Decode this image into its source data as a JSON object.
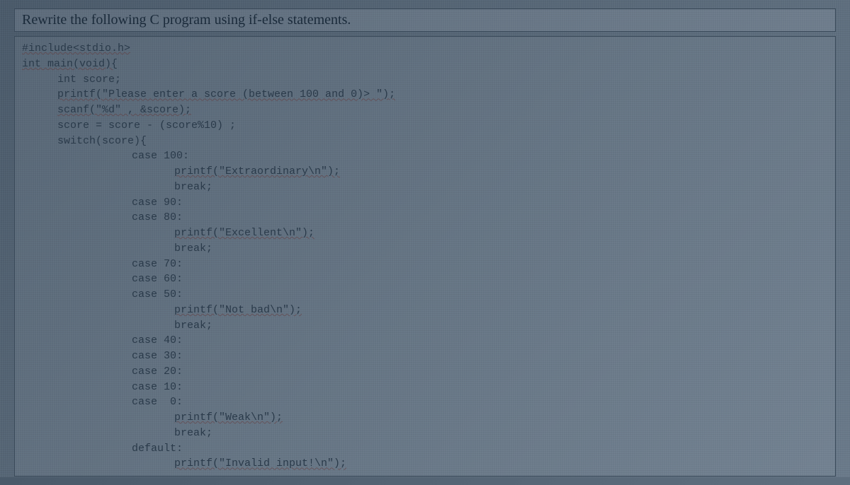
{
  "prompt": "Rewrite the following C program using if-else statements.",
  "code": {
    "l01": "#include<stdio.h>",
    "l02": "int main(void){",
    "l03": "int score;",
    "l04": "printf(\"Please enter a score (between 100 and 0)> \");",
    "l05": "scanf(\"%d\" , &score);",
    "l06": "score = score - (score%10) ;",
    "l07": "switch(score){",
    "l08": "case 100:",
    "l09": "printf(\"Extraordinary\\n\");",
    "l10": "break;",
    "l11": "case 90:",
    "l12": "case 80:",
    "l13": "printf(\"Excellent\\n\");",
    "l14": "break;",
    "l15": "case 70:",
    "l16": "case 60:",
    "l17": "case 50:",
    "l18": "printf(\"Not bad\\n\");",
    "l19": "break;",
    "l20": "case 40:",
    "l21": "case 30:",
    "l22": "case 20:",
    "l23": "case 10:",
    "l24": "case  0:",
    "l25": "printf(\"Weak\\n\");",
    "l26": "break;",
    "l27": "default:",
    "l28": "printf(\"Invalid input!\\n\");"
  }
}
